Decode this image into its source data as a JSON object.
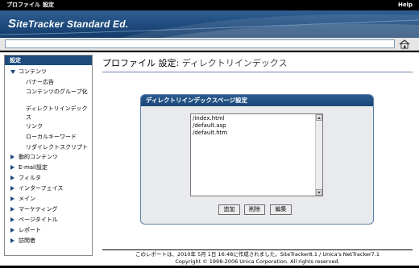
{
  "menu": {
    "profile": "プロファイル",
    "settings": "設定",
    "help": "Help"
  },
  "brand": {
    "logo_initial": "S",
    "logo_rest": "iteTracker Standard Ed."
  },
  "toolbar": {
    "home_icon": "home-icon"
  },
  "sidebar": {
    "header": "設定",
    "items": [
      {
        "label": "コンテンツ",
        "expanded": true
      },
      {
        "label": "動的コンテンツ"
      },
      {
        "label": "E-mail設定"
      },
      {
        "label": "フィルタ"
      },
      {
        "label": "インターフェイス"
      },
      {
        "label": "メイン"
      },
      {
        "label": "マーケティング"
      },
      {
        "label": "ページタイトル"
      },
      {
        "label": "レポート"
      },
      {
        "label": "訪問者"
      }
    ],
    "sub_items": [
      "バナー広告",
      "コンテンツのグループ化",
      "ディレクトリインデックス",
      "リンク",
      "ローカルキーワード",
      "リダイレクトスクリプト"
    ]
  },
  "page": {
    "title_prefix": "プロファイル 設定:",
    "title_main": " ディレクトリインデックス"
  },
  "panel": {
    "title": "ディレクトリインデックスページ設定",
    "list": [
      "/index.html",
      "/default.asp",
      "/default.htm"
    ],
    "buttons": {
      "add": "追加",
      "delete": "削除",
      "edit": "編集"
    }
  },
  "footer": {
    "line1": "このレポートは、2010年 5月 1日 16:48に作成されました。SiteTracker8.1 / Unica's NetTracker7.1",
    "line2": "Copyright © 1998-2006 Unica Corporation. All rights reserved."
  },
  "colors": {
    "accent": "#1e4a7c",
    "panel_bg": "#e8eaed"
  }
}
